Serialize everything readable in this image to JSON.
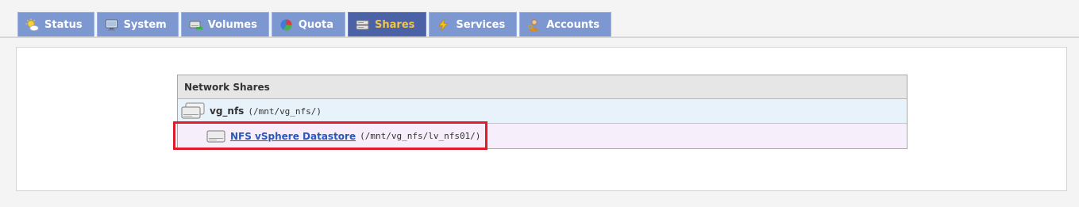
{
  "tabs": [
    {
      "label": "Status",
      "icon": "weather-sun-cloud-icon",
      "active": false
    },
    {
      "label": "System",
      "icon": "monitor-icon",
      "active": false
    },
    {
      "label": "Volumes",
      "icon": "drive-arrow-icon",
      "active": false
    },
    {
      "label": "Quota",
      "icon": "pie-chart-icon",
      "active": false
    },
    {
      "label": "Shares",
      "icon": "drive-tray-icon",
      "active": true
    },
    {
      "label": "Services",
      "icon": "lightning-icon",
      "active": false
    },
    {
      "label": "Accounts",
      "icon": "user-key-icon",
      "active": false
    }
  ],
  "shares": {
    "header": "Network Shares",
    "volume_group": {
      "name": "vg_nfs",
      "path": "(/mnt/vg_nfs/)",
      "icon": "drive-stack-icon"
    },
    "share": {
      "name": "NFS vSphere Datastore",
      "path": "(/mnt/vg_nfs/lv_nfs01/)",
      "icon": "hard-drive-icon"
    }
  },
  "colors": {
    "tab_bg": "#7d97d0",
    "tab_active_bg": "#4b62a6",
    "tab_active_text": "#f0c54a",
    "link": "#2a57b8",
    "highlight": "#e01b2a"
  }
}
